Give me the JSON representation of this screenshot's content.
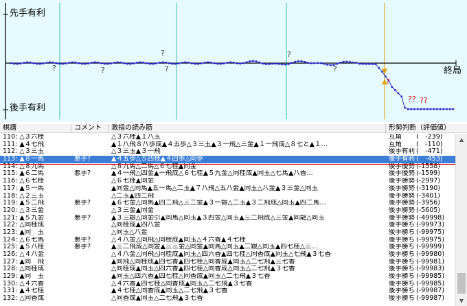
{
  "graph": {
    "label_sente": "先手有利",
    "label_gote": "後手有利",
    "label_end": "終局",
    "question_marks": [
      "?",
      "?",
      "?",
      "?",
      "?",
      "?",
      "?",
      "??",
      "??"
    ],
    "colors": {
      "background": "#e6fbff",
      "line": "#2b2bd0",
      "axis": "#000000",
      "gridline": "#40b8b8",
      "cursor": "#e0a000",
      "question": "#e01818"
    }
  },
  "table": {
    "headers": {
      "move": "棋譜",
      "comment": "コメント",
      "line": "激指の読み筋",
      "judge": "形勢判断（評価値）"
    },
    "rows": [
      {
        "move": "110: △３六桂",
        "comment": "",
        "line": "△３六桂▲１八玉",
        "judge": "互角",
        "score": "(　-239)"
      },
      {
        "move": "111: ▲４七飛",
        "comment": "",
        "line": "▲１八飛８八歩成▲４五歩△３三玉▲３一飛△三金▲１一飛成△８七と▲１…",
        "judge": "互角",
        "score": "(　-110)"
      },
      {
        "move": "112: △３三玉",
        "comment": "",
        "line": "△３三玉▲３一飛",
        "judge": "後手有利",
        "score": "(　-471)"
      },
      {
        "move": "113: ▲８一馬",
        "comment": "悪手?",
        "line": "▲４五歩△５四桂▲４四歩△同歩",
        "judge": "後手有利",
        "score": "(　-453)"
      },
      {
        "move": "114: △８九馬",
        "comment": "",
        "line": "△８九馬△二馬△６七桂▲同金",
        "judge": "後手優勢",
        "score": "(-1558)"
      },
      {
        "move": "115: ▲６二馬",
        "comment": "悪手?",
        "line": "▲４一飛△四金▲一飛成△６七桂▲５九金△同桂成▲同玉△七馬▲八香…",
        "judge": "後手優勢",
        "score": "(-1599)"
      },
      {
        "move": "116: △６七桂",
        "comment": "",
        "line": "△６七桂▲同金",
        "judge": "後手勝勢",
        "score": "(-2997)"
      },
      {
        "move": "117: ▲５一馬",
        "comment": "",
        "line": "▲同金△同馬▲五一馬△二玉▲７八飛△五八金▲同玉△八金▲３三金△同玉",
        "judge": "後手勝勢",
        "score": "(-3190)"
      },
      {
        "move": "118: △２三玉",
        "comment": "",
        "line": "△二玉▲四二飛",
        "judge": "後手勝勢",
        "score": "(-3401)"
      },
      {
        "move": "119: ▲５二飛",
        "comment": "悪手?",
        "line": "▲６七金△同馬▲四二飛△三二金▲３一銀△二玉▲３二飛成△同玉▲四二馬…",
        "judge": "後手勝勢",
        "score": "(-3956)"
      },
      {
        "move": "120: △３三金",
        "comment": "",
        "line": "△３三金▲同金",
        "judge": "後手勝勢",
        "score": "(-5605)"
      },
      {
        "move": "121: ▲５九金",
        "comment": "悪手?",
        "line": "▲３三銀△同金引▲同馬△同玉▲３四金△同玉▲三二飛成△三金▲同龍△同玉",
        "judge": "後手勝勢",
        "score": "(-49998)"
      },
      {
        "move": "122: △同桂成",
        "comment": "",
        "line": "△同桂成▲四八金",
        "judge": "後手勝ち",
        "score": "(-99973)"
      },
      {
        "move": "123: ▲同　玉",
        "comment": "",
        "line": "△同玉△八金",
        "judge": "後手勝ち",
        "score": "(-99975)"
      },
      {
        "move": "124: △６七馬",
        "comment": "悪手?",
        "line": "△４八金△同飛△同桂成▲同玉△４六香▲４七桂",
        "judge": "後手勝ち",
        "score": "(-99975)"
      },
      {
        "move": "125: ▲５八桂",
        "comment": "悪手?",
        "line": "▲三二飛成△同金▲三三金△同金▲同馬△同玉▲二銀△同玉▲四七桂△三…",
        "judge": "後手勝ち",
        "score": "(-99999)"
      },
      {
        "move": "126: △４八金",
        "comment": "",
        "line": "△４八金△同飛△同桂成▲同玉△四六香▲四七桂△同香成▲同玉△七飛▲３七香",
        "judge": "後手勝ち",
        "score": "(-99980)"
      },
      {
        "move": "127: ▲同　飛",
        "comment": "",
        "line": "▲同飛△同桂成▲四七香▲四七桂△同香成▲同玉△二七飛▲三七香",
        "judge": "後手勝ち",
        "score": "(-99981)"
      },
      {
        "move": "128: △同桂成",
        "comment": "",
        "line": "△同桂成▲同玉△四六香▲四七桂△同香成△同玉△二七飛▲３七香",
        "judge": "後手勝ち",
        "score": "(-99983)"
      },
      {
        "move": "129: ▲同　玉",
        "comment": "",
        "line": "▲同玉△四六香▲四七桂△同香成▲同玉△二七飛▲３七香",
        "judge": "後手勝ち",
        "score": "(-99985)"
      },
      {
        "move": "130: △４六香",
        "comment": "",
        "line": "△４六香▲四七桂△同香成▲同玉△二七飛▲３七香",
        "judge": "後手勝ち",
        "score": "(-99985)"
      },
      {
        "move": "131: ▲４七桂",
        "comment": "",
        "line": "▲４七桂△同香成▲同玉△二七飛▲３七香",
        "judge": "後手勝ち",
        "score": "(-99987)"
      },
      {
        "move": "132: △同香成",
        "comment": "",
        "line": "△同香成▲同玉△二七飛▲３七香",
        "judge": "後手勝ち",
        "score": "(-99987)"
      }
    ]
  }
}
